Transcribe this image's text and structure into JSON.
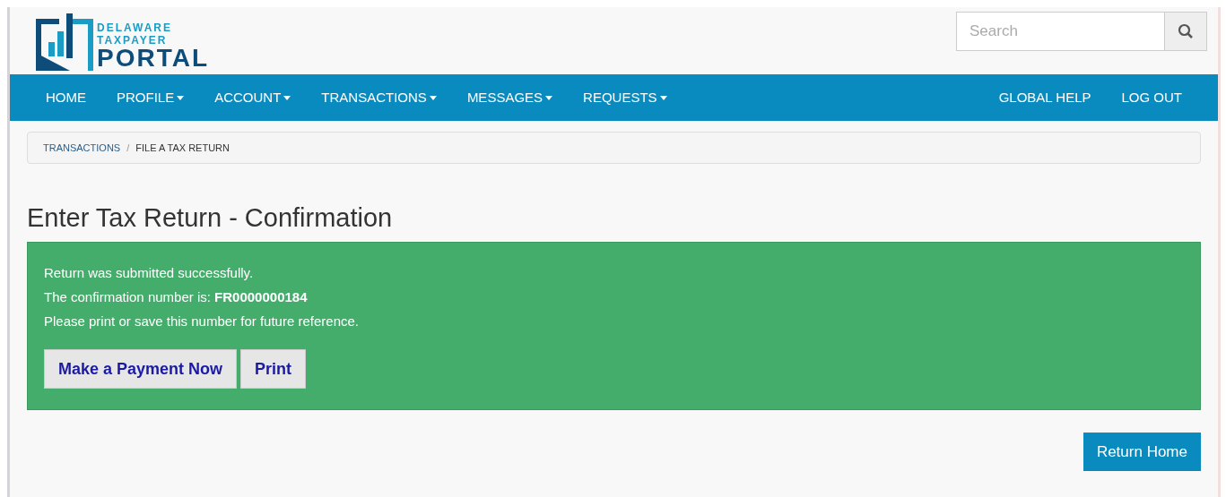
{
  "logo": {
    "line_1": "DELAWARE",
    "line_2": "TAXPAYER",
    "line_3": "PORTAL"
  },
  "search": {
    "placeholder": "Search"
  },
  "nav": {
    "left": [
      {
        "label": "HOME",
        "dropdown": false
      },
      {
        "label": "PROFILE",
        "dropdown": true
      },
      {
        "label": "ACCOUNT",
        "dropdown": true
      },
      {
        "label": "TRANSACTIONS",
        "dropdown": true
      },
      {
        "label": "MESSAGES",
        "dropdown": true
      },
      {
        "label": "REQUESTS",
        "dropdown": true
      }
    ],
    "right": [
      {
        "label": "GLOBAL HELP",
        "dropdown": false
      },
      {
        "label": "LOG OUT",
        "dropdown": false
      }
    ]
  },
  "breadcrumb": {
    "separator": "/",
    "items": [
      "TRANSACTIONS",
      "FILE A TAX RETURN"
    ]
  },
  "page_title": "Enter Tax Return - Confirmation",
  "alert": {
    "lines": [
      "Return was submitted successfully.",
      "The confirmation number is: **FR0000000184**",
      "Please print or save this number for future reference."
    ],
    "buttons": [
      "Make a Payment Now",
      "Print"
    ]
  },
  "return_button": "Return Home"
}
